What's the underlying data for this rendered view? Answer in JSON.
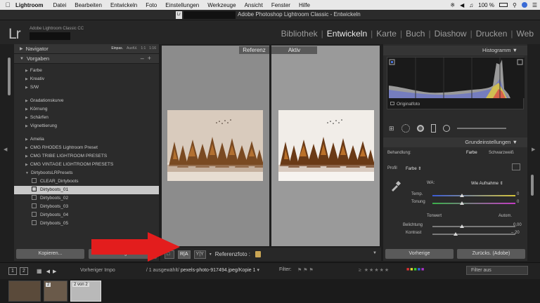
{
  "menubar": {
    "app": "Lightroom",
    "items": [
      "Datei",
      "Bearbeiten",
      "Entwickeln",
      "Foto",
      "Einstellungen",
      "Werkzeuge",
      "Ansicht",
      "Fenster",
      "Hilfe"
    ],
    "battery": "100 %"
  },
  "window": {
    "title": "Adobe Photoshop Lightroom Classic - Entwickeln"
  },
  "identity": {
    "logo": "Lr",
    "product": "Adobe Lightroom Classic CC"
  },
  "modules": [
    "Bibliothek",
    "Entwickeln",
    "Karte",
    "Buch",
    "Diashow",
    "Drucken",
    "Web"
  ],
  "active_module": "Entwickeln",
  "left": {
    "navigator": {
      "title": "Navigator",
      "options": [
        "Einpas.",
        "Ausfül.",
        "1:1",
        "1:16"
      ]
    },
    "presets": {
      "title": "Vorgaben",
      "groups_a": [
        "Farbe",
        "Kreativ",
        "S/W"
      ],
      "groups_b": [
        "Gradationskurve",
        "Körnung",
        "Schärfen",
        "Vignettierung"
      ],
      "groups_c": [
        "Amelia",
        "CMG RHODES Lightroom Preset",
        "CMG TRIBE LIGHTROOM PRESETS",
        "CMG VINTAGE LIGHTROOM PRESETS",
        "DirtybootsLRPresets"
      ],
      "items": [
        "CLEAR_Dirtyboots",
        "Dirtyboots_01",
        "Dirtyboots_02",
        "Dirtyboots_03",
        "Dirtyboots_04",
        "Dirtyboots_05"
      ],
      "selected": "Dirtyboots_01"
    },
    "buttons": [
      "Kopieren...",
      "Einfügen"
    ]
  },
  "center": {
    "ref_label": "Referenz",
    "active_label": "Aktiv",
    "toolbar": {
      "ref_photo_label": "Referenzfoto :"
    }
  },
  "right": {
    "histogram_title": "Histogramm",
    "original_label": "Originalfoto",
    "basic_title": "Grundeinstellungen",
    "treatment_label": "Behandlung:",
    "treatment_color": "Farbe",
    "treatment_bw": "Schwarzweiß",
    "profile_label": "Profil",
    "profile_value": "Farbe",
    "wb_label": "WA:",
    "wb_value": "Wie Aufnahme",
    "temp_label": "Temp.",
    "temp_value": "0",
    "tint_label": "Tonung",
    "tint_value": "0",
    "tone_label": "Tonwert",
    "auto_label": "Autom.",
    "exposure_label": "Belichtung",
    "exposure_value": "0,00",
    "contrast_label": "Kontrast",
    "contrast_value": "– 20",
    "buttons": [
      "Vorherige",
      "Zurücks. (Adobe)"
    ]
  },
  "filmbar": {
    "pages": [
      "1",
      "2"
    ],
    "source_prefix": "Vorheriger Impo",
    "source_mid": "/ 1 ausgewählt/",
    "source_file": "pexels-photo-917494.jpeg/Kopie 1",
    "filter_label": "Filter:",
    "filter_value": "Filter aus"
  },
  "filmstrip": {
    "thumbs": [
      {
        "badge": ""
      },
      {
        "badge": "2"
      },
      {
        "badge": "2 von 2"
      }
    ]
  },
  "colors": {
    "accent_arrow": "#e31d1d",
    "panel": "#2b2b2b",
    "lock": "#c9a554"
  }
}
